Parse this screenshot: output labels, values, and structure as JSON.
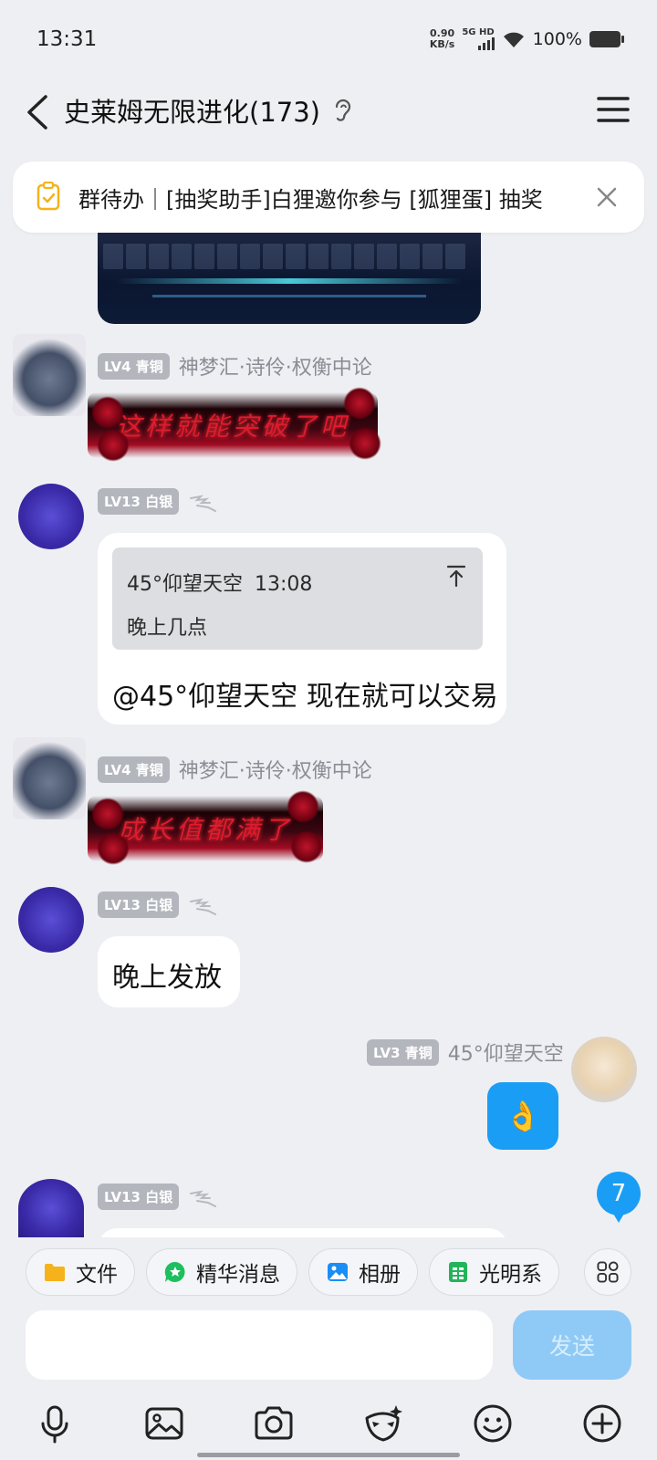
{
  "status_bar": {
    "time": "13:31",
    "net_speed_value": "0.90",
    "net_speed_unit": "KB/s",
    "network_type": "5G HD",
    "battery": "100%"
  },
  "header": {
    "title": "史莱姆无限进化(173)"
  },
  "todo": {
    "text": "群待办｜[抽奖助手]白狸邀你参与 [狐狸蛋] 抽奖"
  },
  "messages": [
    {
      "badge": "LV4 青铜",
      "name": "神梦汇·诗伶·权衡中论",
      "sticker_text": "这样就能突破了吧"
    },
    {
      "badge": "LV13 白银",
      "quote_author": "45°仰望天空",
      "quote_time": "13:08",
      "quote_text": "晚上几点",
      "text": "@45°仰望天空 现在就可以交易"
    },
    {
      "badge": "LV4 青铜",
      "name": "神梦汇·诗伶·权衡中论",
      "sticker_text": "成长值都满了"
    },
    {
      "badge": "LV13 白银",
      "text": "晚上发放"
    },
    {
      "badge": "LV3 青铜",
      "name": "45°仰望天空",
      "text": "👌"
    },
    {
      "badge": "LV13 白银"
    }
  ],
  "unread_count": "7",
  "quick_actions": [
    {
      "label": "文件",
      "icon": "folder-icon",
      "color": "#f5b21a"
    },
    {
      "label": "精华消息",
      "icon": "star-bubble-icon",
      "color": "#1dbf5e"
    },
    {
      "label": "相册",
      "icon": "photo-icon",
      "color": "#1a8ef5"
    },
    {
      "label": "光明系",
      "icon": "doc-icon",
      "color": "#22b45a"
    }
  ],
  "input": {
    "send_label": "发送"
  },
  "colors": {
    "accent": "#1a9ef5",
    "background": "#eeeff3",
    "badge_bg": "#b3b6bd"
  }
}
